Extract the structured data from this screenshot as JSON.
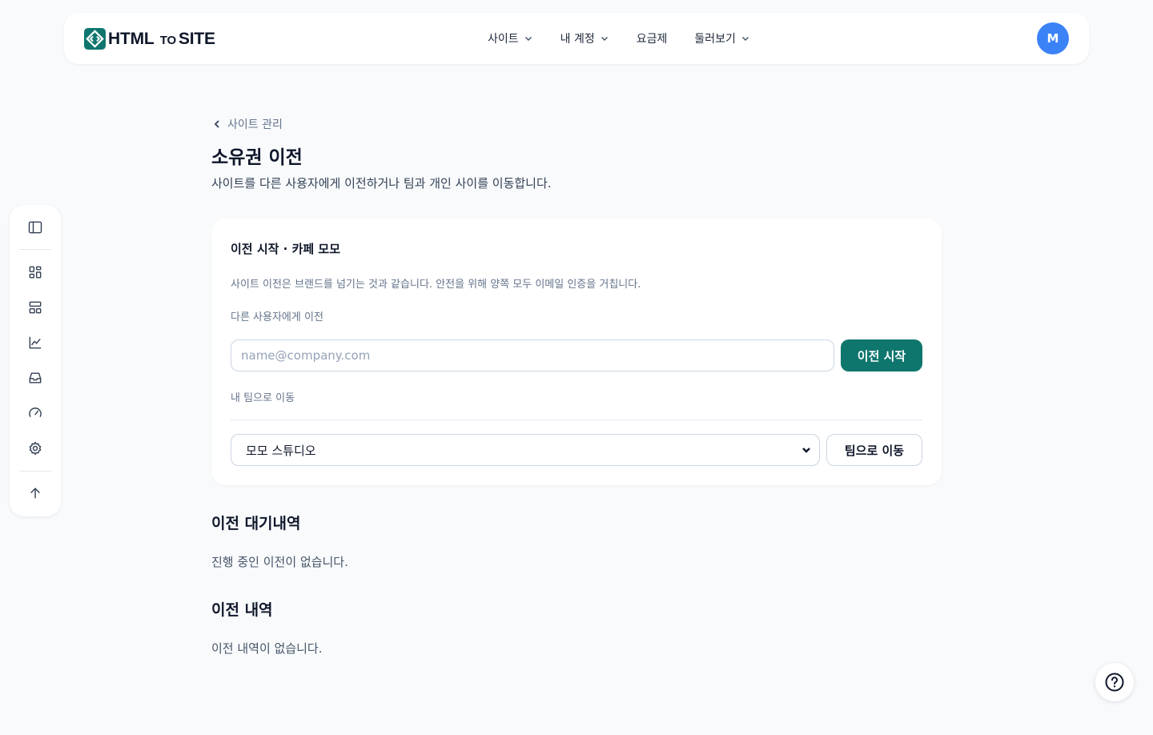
{
  "brand": {
    "name_left": "HTML",
    "name_mid": "TO",
    "name_right": "SITE",
    "accent": "#0f766e"
  },
  "nav": [
    {
      "label": "사이트",
      "has_menu": true
    },
    {
      "label": "내 계정",
      "has_menu": true
    },
    {
      "label": "요금제",
      "has_menu": false
    },
    {
      "label": "둘러보기",
      "has_menu": true
    }
  ],
  "user": {
    "initial": "M",
    "avatar_color": "#3b82f6"
  },
  "rail": {
    "items": [
      "sidebar-toggle-icon",
      "dashboard-icon",
      "layout-icon",
      "chart-icon",
      "inbox-icon",
      "gauge-icon",
      "settings-icon",
      "arrow-up-icon"
    ]
  },
  "breadcrumb": {
    "label": "사이트 관리"
  },
  "page": {
    "title": "소유권 이전",
    "subtitle": "사이트를 다른 사용자에게 이전하거나 팀과 개인 사이를 이동합니다."
  },
  "card": {
    "title": "이전 시작 · 카페 모모",
    "description": "사이트 이전은 브랜드를 넘기는 것과 같습니다. 안전을 위해 양쪽 모두 이메일 인증을 거칩니다.",
    "transfer_label": "다른 사용자에게 이전",
    "email_placeholder": "name@company.com",
    "email_value": "",
    "start_button": "이전 시작",
    "team_label": "내 팀으로 이동",
    "team_selected": "모모 스튜디오",
    "team_button": "팀으로 이동"
  },
  "pending": {
    "heading": "이전 대기내역",
    "empty": "진행 중인 이전이 없습니다."
  },
  "history": {
    "heading": "이전 내역",
    "empty": "이전 내역이 없습니다."
  },
  "help": {
    "icon": "help-icon"
  }
}
